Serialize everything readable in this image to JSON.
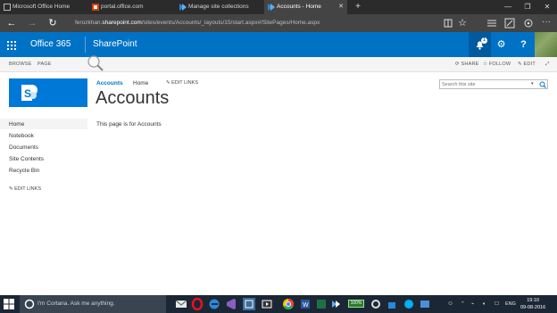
{
  "browser": {
    "tabs": [
      {
        "label": "Microsoft Office Home"
      },
      {
        "label": "portal.office.com"
      },
      {
        "label": "Manage site collections"
      },
      {
        "label": "Accounts - Home"
      }
    ],
    "new_tab": "+",
    "url_prefix": "ferozkhan.",
    "url_host": "sharepoint.com",
    "url_path": "/sites/events/Accounts/_layouts/15/start.aspx#/SitePages/Home.aspx"
  },
  "suite": {
    "office365_label": "Office 365",
    "app_label": "SharePoint",
    "notification_count": "1",
    "help_label": "?"
  },
  "ribbon": {
    "browse": "BROWSE",
    "page": "PAGE",
    "share": "SHARE",
    "follow": "FOLLOW",
    "edit": "EDIT"
  },
  "page": {
    "crumb_site": "Accounts",
    "crumb_home": "Home",
    "edit_links": "EDIT LINKS",
    "title": "Accounts",
    "search_placeholder": "Search this site",
    "body_text": "This page is for Accounts"
  },
  "left_nav": {
    "items": [
      {
        "label": "Home"
      },
      {
        "label": "Notebook"
      },
      {
        "label": "Documents"
      },
      {
        "label": "Site Contents"
      },
      {
        "label": "Recycle Bin"
      }
    ],
    "edit_links": "EDIT LINKS"
  },
  "taskbar": {
    "cortana_placeholder": "I'm Cortana. Ask me anything.",
    "battery": "100%",
    "language": "ENG",
    "time": "19:10",
    "date": "09-08-2016"
  },
  "colors": {
    "suite_blue": "#0072c6",
    "tab_bar": "#2b2b2b",
    "taskbar": "#1c2735"
  }
}
